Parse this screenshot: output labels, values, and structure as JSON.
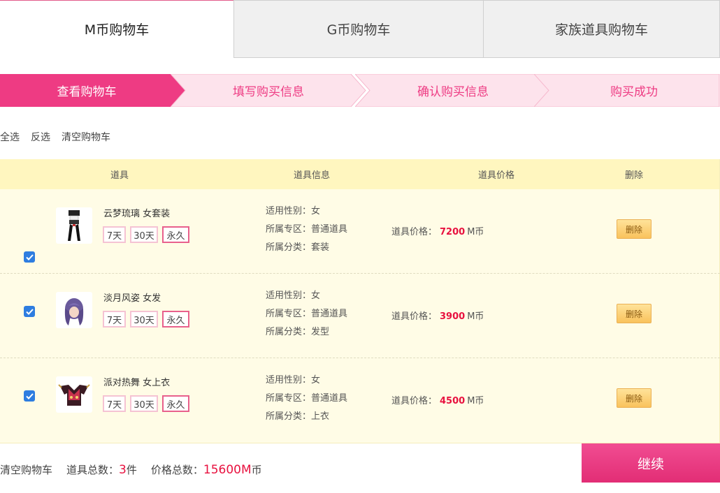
{
  "tabs": [
    {
      "label": "M币购物车",
      "active": true
    },
    {
      "label": "G币购物车",
      "active": false
    },
    {
      "label": "家族道具购物车",
      "active": false
    }
  ],
  "steps": [
    {
      "label": "查看购物车",
      "active": true
    },
    {
      "label": "填写购买信息",
      "active": false
    },
    {
      "label": "确认购买信息",
      "active": false
    },
    {
      "label": "购买成功",
      "active": false
    }
  ],
  "tools": {
    "select_all": "全选",
    "invert": "反选",
    "clear": "清空购物车"
  },
  "table": {
    "headers": [
      "道具",
      "道具信息",
      "道具价格",
      "删除"
    ],
    "rows": [
      {
        "name": "云梦琉璃 女套装",
        "durations": [
          "7天",
          "30天",
          "永久"
        ],
        "gender": "适用性别：女",
        "zone": "所属专区：普通道具",
        "category": "所属分类：套装",
        "price_label": "道具价格：",
        "price": "7200",
        "unit": "M币",
        "delete": "删除",
        "thumb": "outfit-icon"
      },
      {
        "name": "淡月风姿 女发",
        "durations": [
          "7天",
          "30天",
          "永久"
        ],
        "gender": "适用性别：女",
        "zone": "所属专区：普通道具",
        "category": "所属分类：发型",
        "price_label": "道具价格：",
        "price": "3900",
        "unit": "M币",
        "delete": "删除",
        "thumb": "hair-icon"
      },
      {
        "name": "派对热舞 女上衣",
        "durations": [
          "7天",
          "30天",
          "永久"
        ],
        "gender": "适用性别：女",
        "zone": "所属专区：普通道具",
        "category": "所属分类：上衣",
        "price_label": "道具价格：",
        "price": "4500",
        "unit": "M币",
        "delete": "删除",
        "thumb": "top-icon"
      }
    ]
  },
  "footer": {
    "clear": "清空购物车",
    "count_label": "道具总数：",
    "count": "3",
    "count_unit": "件",
    "total_label": "价格总数：",
    "total": "15600M",
    "total_unit": "币",
    "continue": "继续"
  },
  "colors": {
    "accent": "#ee3b83",
    "step_inactive": "#fde3ec",
    "price": "#e8113f"
  }
}
